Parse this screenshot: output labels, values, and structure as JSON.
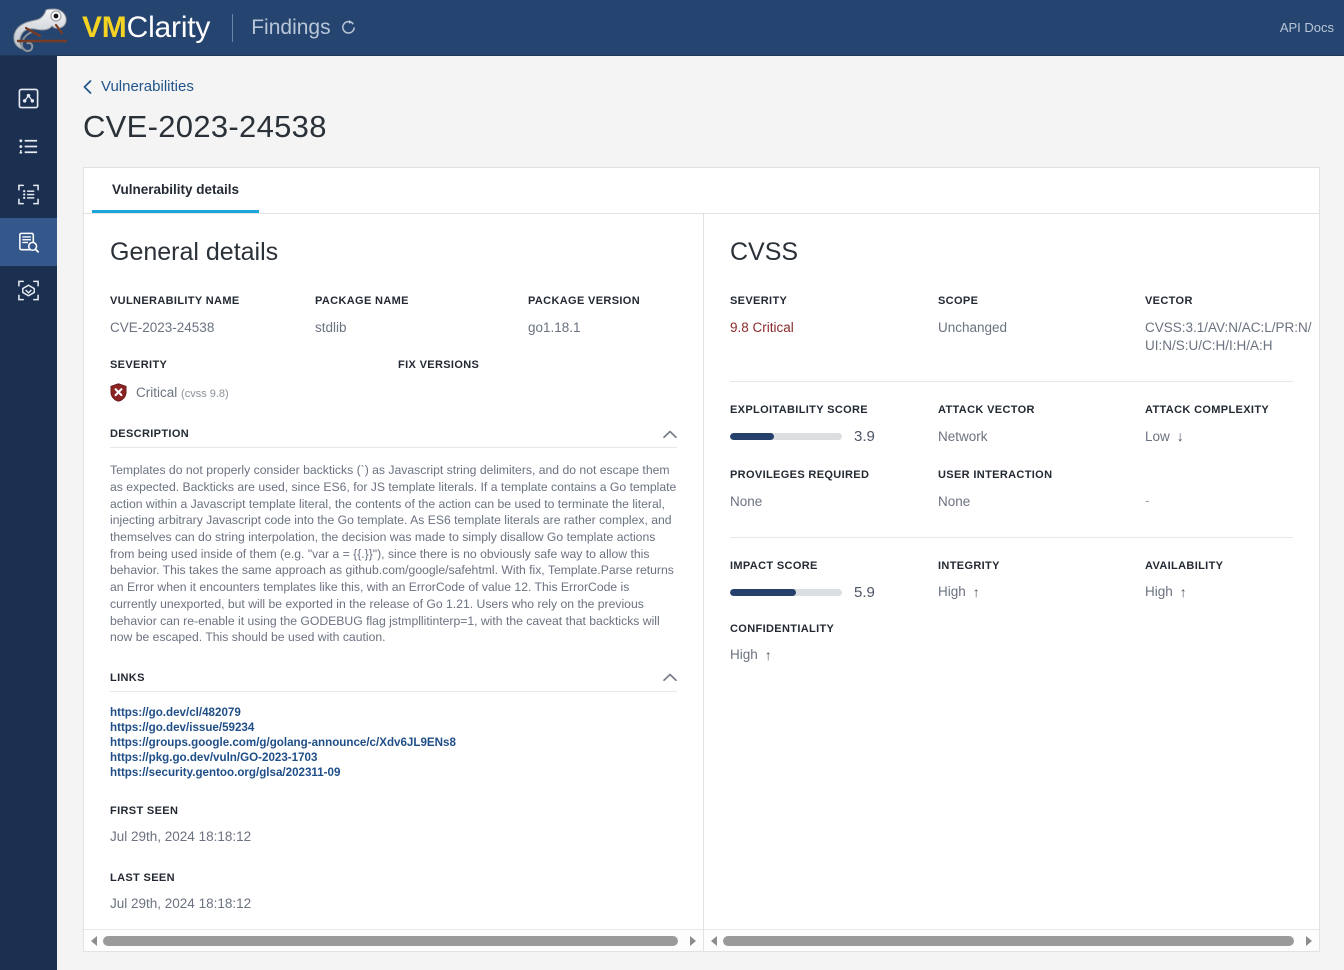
{
  "header": {
    "brand_vm": "VM",
    "brand_clarity": "Clarity",
    "section": "Findings",
    "refresh_icon": "refresh-icon",
    "api_docs": "API Docs"
  },
  "sidebar": {
    "items": [
      {
        "icon": "dashboard-icon",
        "name": "sidebar-item-dashboard",
        "active": false
      },
      {
        "icon": "list-icon",
        "name": "sidebar-item-scans",
        "active": false
      },
      {
        "icon": "scan-config-icon",
        "name": "sidebar-item-scan-configs",
        "active": false
      },
      {
        "icon": "findings-icon",
        "name": "sidebar-item-findings",
        "active": true
      },
      {
        "icon": "assets-icon",
        "name": "sidebar-item-assets",
        "active": false
      }
    ]
  },
  "breadcrumb": {
    "back_icon": "chevron-left-icon",
    "label": "Vulnerabilities"
  },
  "page_title": "CVE-2023-24538",
  "tabs": [
    {
      "label": "Vulnerability details",
      "active": true
    }
  ],
  "general_details": {
    "title": "General details",
    "fields": {
      "vulnerability_name_label": "VULNERABILITY NAME",
      "vulnerability_name_value": "CVE-2023-24538",
      "package_name_label": "PACKAGE NAME",
      "package_name_value": "stdlib",
      "package_version_label": "PACKAGE VERSION",
      "package_version_value": "go1.18.1",
      "severity_label": "SEVERITY",
      "severity_value": "Critical",
      "severity_cvss": "(cvss 9.8)",
      "severity_icon": "shield-critical-icon",
      "fix_versions_label": "FIX VERSIONS",
      "fix_versions_value": ""
    },
    "description": {
      "label": "DESCRIPTION",
      "collapse_icon": "chevron-up-icon",
      "text": "Templates do not properly consider backticks (`) as Javascript string delimiters, and do not escape them as expected. Backticks are used, since ES6, for JS template literals. If a template contains a Go template action within a Javascript template literal, the contents of the action can be used to terminate the literal, injecting arbitrary Javascript code into the Go template. As ES6 template literals are rather complex, and themselves can do string interpolation, the decision was made to simply disallow Go template actions from being used inside of them (e.g. \"var a = {{.}}\"), since there is no obviously safe way to allow this behavior. This takes the same approach as github.com/google/safehtml. With fix, Template.Parse returns an Error when it encounters templates like this, with an ErrorCode of value 12. This ErrorCode is currently unexported, but will be exported in the release of Go 1.21. Users who rely on the previous behavior can re-enable it using the GODEBUG flag jstmpllitinterp=1, with the caveat that backticks will now be escaped. This should be used with caution."
    },
    "links": {
      "label": "LINKS",
      "collapse_icon": "chevron-up-icon",
      "items": [
        "https://go.dev/cl/482079",
        "https://go.dev/issue/59234",
        "https://groups.google.com/g/golang-announce/c/Xdv6JL9ENs8",
        "https://pkg.go.dev/vuln/GO-2023-1703",
        "https://security.gentoo.org/glsa/202311-09"
      ]
    },
    "first_seen_label": "FIRST SEEN",
    "first_seen_value": "Jul 29th, 2024 18:18:12",
    "last_seen_label": "LAST SEEN",
    "last_seen_value": "Jul 29th, 2024 18:18:12"
  },
  "cvss": {
    "title": "CVSS",
    "severity_label": "SEVERITY",
    "severity_value": "9.8  Critical",
    "scope_label": "SCOPE",
    "scope_value": "Unchanged",
    "vector_label": "VECTOR",
    "vector_value": "CVSS:3.1/AV:N/AC:L/PR:N/UI:N/S:U/C:H/I:H/A:H",
    "exploitability_score_label": "EXPLOITABILITY SCORE",
    "exploitability_score_value": "3.9",
    "attack_vector_label": "ATTACK VECTOR",
    "attack_vector_value": "Network",
    "attack_complexity_label": "ATTACK COMPLEXITY",
    "attack_complexity_value": "Low",
    "attack_complexity_arrow": "↓",
    "privileges_required_label": "PROVILEGES REQUIRED",
    "privileges_required_value": "None",
    "user_interaction_label": "USER INTERACTION",
    "user_interaction_value": "None",
    "empty_value": "-",
    "impact_score_label": "IMPACT SCORE",
    "impact_score_value": "5.9",
    "integrity_label": "INTEGRITY",
    "integrity_value": "High",
    "integrity_arrow": "↑",
    "availability_label": "AVAILABILITY",
    "availability_value": "High",
    "availability_arrow": "↑",
    "confidentiality_label": "CONFIDENTIALITY",
    "confidentiality_value": "High",
    "confidentiality_arrow": "↑"
  },
  "colors": {
    "brand_yellow": "#f5d322",
    "topbar_blue": "#25446f",
    "sidebar_blue": "#1b3050",
    "sidebar_active": "#35588c",
    "accent_cyan": "#1aa5dd",
    "critical_red": "#8a2a2a",
    "bar_fill": "#24406b",
    "link_blue": "#1f4e87"
  }
}
